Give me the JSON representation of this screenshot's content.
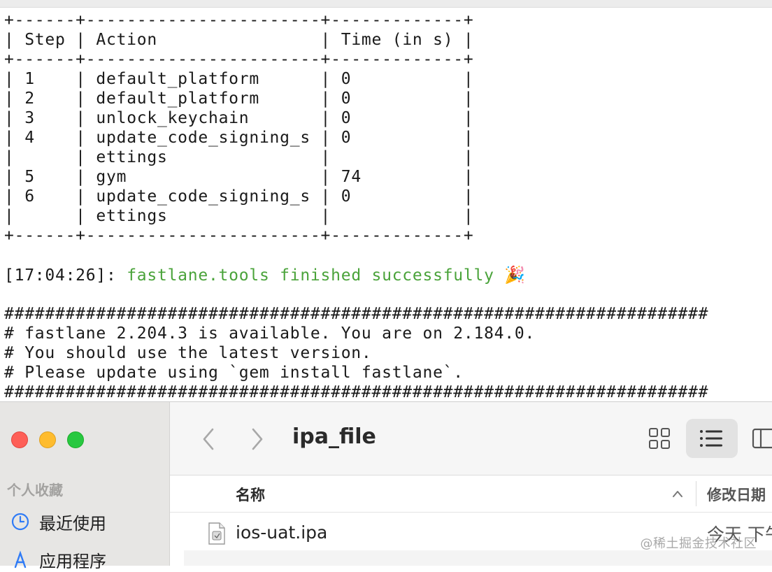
{
  "terminal": {
    "summary_table": {
      "headers": [
        "Step",
        "Action",
        "Time (in s)"
      ],
      "rows": [
        {
          "step": "1",
          "action": "default_platform",
          "time": "0"
        },
        {
          "step": "2",
          "action": "default_platform",
          "time": "0"
        },
        {
          "step": "3",
          "action": "unlock_keychain",
          "time": "0"
        },
        {
          "step": "4",
          "action": "update_code_signing_settings",
          "time": "0"
        },
        {
          "step": "5",
          "action": "gym",
          "time": "74"
        },
        {
          "step": "6",
          "action": "update_code_signing_settings",
          "time": "0"
        }
      ]
    },
    "success_timestamp": "[17:04:26]:",
    "success_message": "fastlane.tools finished successfully",
    "success_emoji": "🎉",
    "update_notice": [
      "# fastlane 2.204.3 is available. You are on 2.184.0.",
      "# You should use the latest version.",
      "# Please update using `gem install fastlane`."
    ],
    "colors": {
      "success": "#4aa33a",
      "text": "#1a1a1a"
    }
  },
  "finder": {
    "sidebar": {
      "section_title": "个人收藏",
      "items": [
        {
          "label": "最近使用",
          "icon": "clock-icon"
        },
        {
          "label": "应用程序",
          "icon": "applications-icon"
        }
      ]
    },
    "toolbar": {
      "title": "ipa_file",
      "back_icon": "chevron-left-icon",
      "forward_icon": "chevron-right-icon",
      "views": [
        "icon-grid-view",
        "list-view",
        "column-view"
      ],
      "selected_view": "list-view"
    },
    "columns": {
      "name": "名称",
      "date": "修改日期"
    },
    "files": [
      {
        "name": "ios-uat.ipa",
        "date": "今天 下午"
      }
    ],
    "watermark": "@稀土掘金技术社区"
  }
}
